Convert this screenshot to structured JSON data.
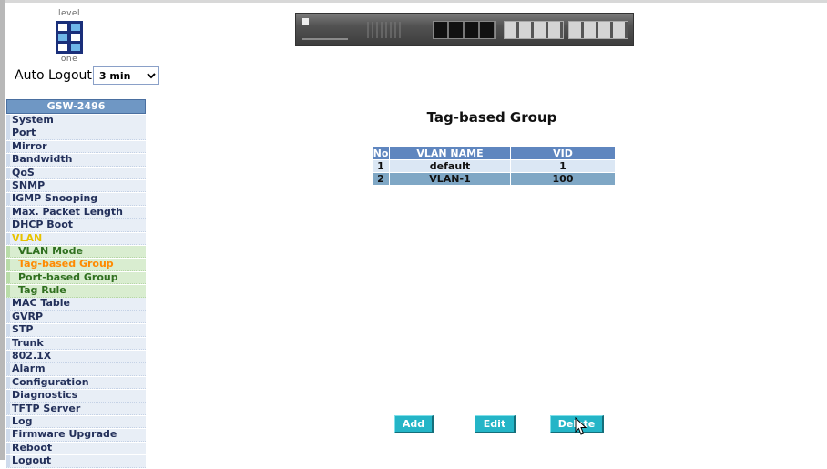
{
  "logo": {
    "top_text": "level",
    "bottom_text": "one"
  },
  "auto_logout": {
    "label": "Auto Logout",
    "selected": "3 min"
  },
  "sidebar": {
    "title": "GSW-2496",
    "items": [
      {
        "label": "System"
      },
      {
        "label": "Port"
      },
      {
        "label": "Mirror"
      },
      {
        "label": "Bandwidth"
      },
      {
        "label": "QoS"
      },
      {
        "label": "SNMP"
      },
      {
        "label": "IGMP Snooping"
      },
      {
        "label": "Max. Packet Length"
      },
      {
        "label": "DHCP Boot"
      },
      {
        "label": "VLAN"
      },
      {
        "label": "VLAN Mode"
      },
      {
        "label": "Tag-based Group"
      },
      {
        "label": "Port-based Group"
      },
      {
        "label": "Tag Rule"
      },
      {
        "label": "MAC Table"
      },
      {
        "label": "GVRP"
      },
      {
        "label": "STP"
      },
      {
        "label": "Trunk"
      },
      {
        "label": "802.1X"
      },
      {
        "label": "Alarm"
      },
      {
        "label": "Configuration"
      },
      {
        "label": "Diagnostics"
      },
      {
        "label": "TFTP Server"
      },
      {
        "label": "Log"
      },
      {
        "label": "Firmware Upgrade"
      },
      {
        "label": "Reboot"
      },
      {
        "label": "Logout"
      }
    ]
  },
  "main": {
    "title": "Tag-based Group",
    "table": {
      "headers": [
        "No",
        "VLAN NAME",
        "VID"
      ],
      "rows": [
        [
          "1",
          "default",
          "1"
        ],
        [
          "2",
          "VLAN-1",
          "100"
        ]
      ]
    },
    "buttons": {
      "add": "Add",
      "edit": "Edit",
      "delete": "Delete"
    }
  },
  "colors": {
    "sidebar_title_bg": "#6f97c4",
    "submenu_bg": "#d9edd0",
    "active_item": "#ff8a00",
    "open_section": "#e7c200",
    "button_bg": "#24b5c7",
    "table_header_bg": "#5f86bf"
  }
}
